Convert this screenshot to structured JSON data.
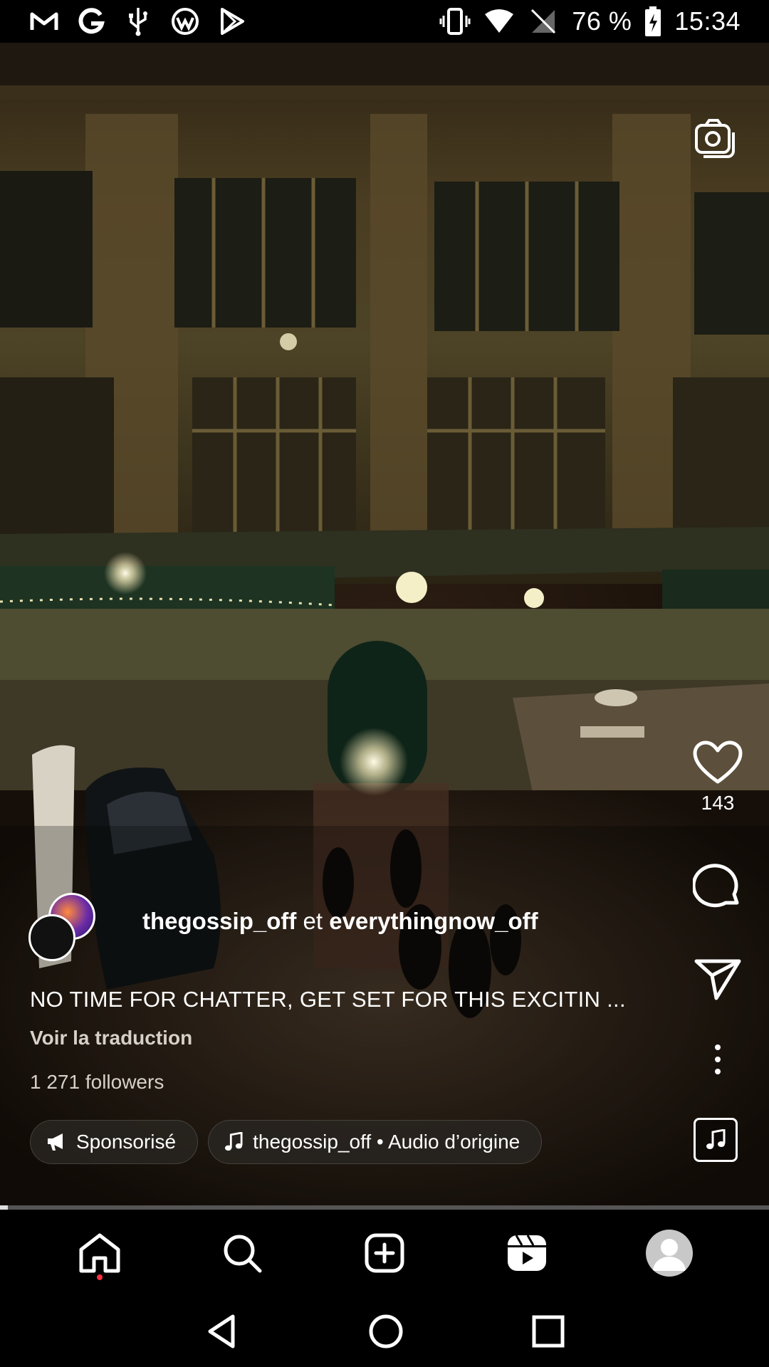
{
  "status_bar": {
    "left_icons": [
      "gmail-icon",
      "google-icon",
      "usb-icon",
      "app-icon",
      "play-store-icon"
    ],
    "battery_percent": "76 %",
    "time": "15:34"
  },
  "reel": {
    "likes": "143",
    "authors": {
      "primary": "thegossip_off",
      "connector": "et",
      "secondary": "everythingnow_off"
    },
    "caption": "NO TIME FOR CHATTER, GET SET FOR THIS EXCITIN ...",
    "translate_label": "Voir la traduction",
    "followers": "1 271 followers",
    "sponsored_label": "Sponsorisé",
    "audio_label": "thegossip_off • Audio d’origine",
    "progress": 0.01
  },
  "bottom_nav": [
    "home",
    "search",
    "create",
    "reels",
    "profile"
  ]
}
